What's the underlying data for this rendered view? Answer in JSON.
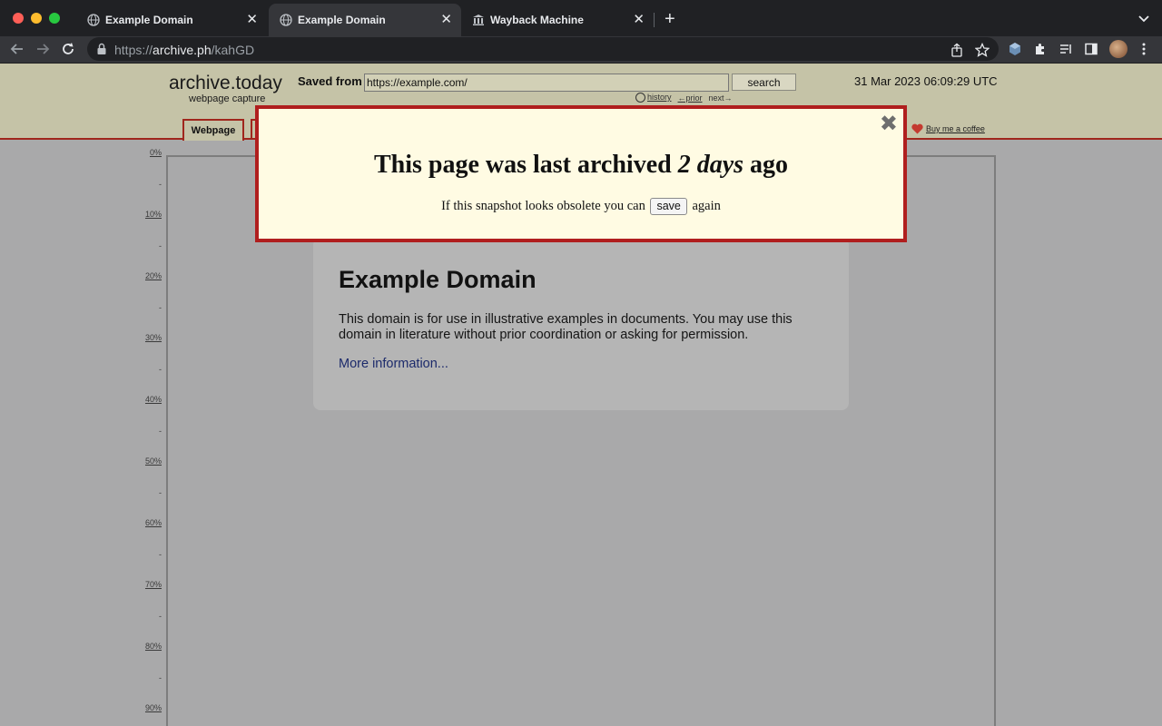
{
  "browser": {
    "tabs": [
      {
        "title": "Example Domain",
        "icon": "globe-icon",
        "active": false
      },
      {
        "title": "Example Domain",
        "icon": "globe-icon",
        "active": true
      },
      {
        "title": "Wayback Machine",
        "icon": "museum-icon",
        "active": false
      }
    ],
    "address": {
      "scheme": "https://",
      "host": "archive.ph",
      "path": "/kahGD"
    }
  },
  "archive": {
    "logo": "archive.today",
    "logo_sub": "webpage capture",
    "saved_from_label": "Saved from",
    "source_url": "https://example.com/",
    "search_label": "search",
    "date": "31 Mar 2023 06:09:29 UTC",
    "history_label": "history",
    "prior_label": "←prior",
    "next_label": "next→",
    "tab_webpage": "Webpage",
    "coffee_label": "Buy me a coffee"
  },
  "ruler": {
    "ticks": [
      "0%",
      "-",
      "10%",
      "-",
      "20%",
      "-",
      "30%",
      "-",
      "40%",
      "-",
      "50%",
      "-",
      "60%",
      "-",
      "70%",
      "-",
      "80%",
      "-",
      "90%"
    ]
  },
  "page": {
    "heading": "Example Domain",
    "body": "This domain is for use in illustrative examples in documents. You may use this domain in literature without prior coordination or asking for permission.",
    "link": "More information..."
  },
  "modal": {
    "title_prefix": "This page was last archived ",
    "title_age": "2 days",
    "title_suffix": " ago",
    "msg_prefix": "If this snapshot looks obsolete you can ",
    "save_label": "save",
    "msg_suffix": " again",
    "close_symbol": "✖"
  }
}
